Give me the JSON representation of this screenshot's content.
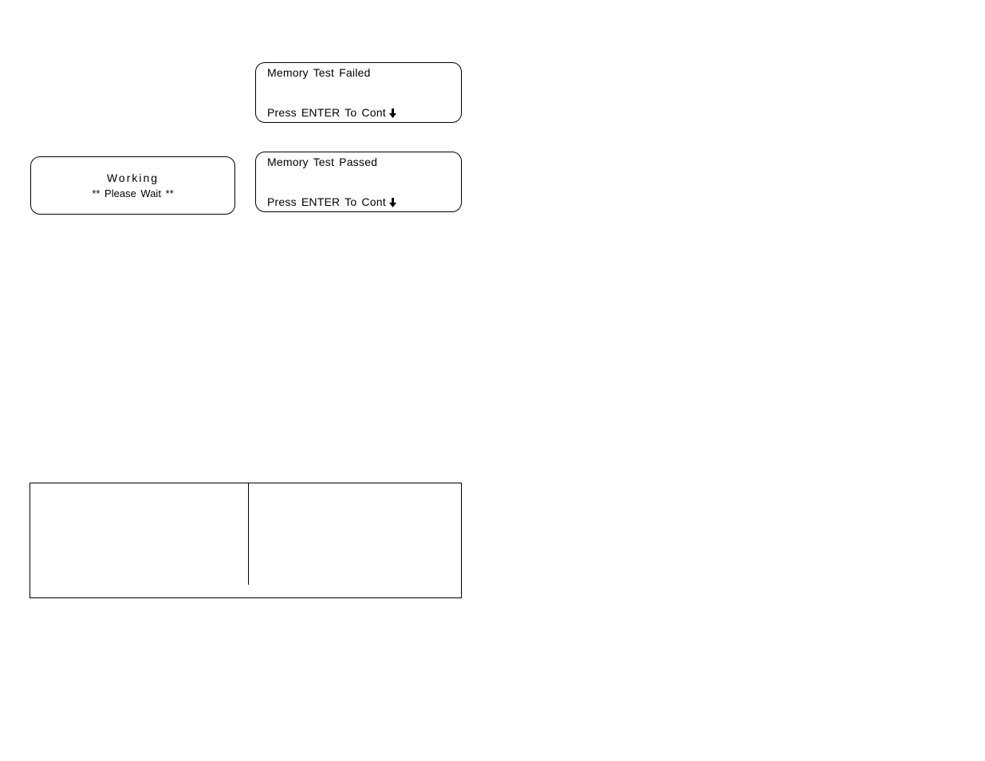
{
  "screens": {
    "working": {
      "line1": "Working",
      "line2": "** Please Wait **"
    },
    "failed": {
      "title": "Memory Test Failed",
      "prompt": "Press ENTER To Cont"
    },
    "passed": {
      "title": "Memory Test Passed",
      "prompt": "Press ENTER To Cont"
    }
  }
}
